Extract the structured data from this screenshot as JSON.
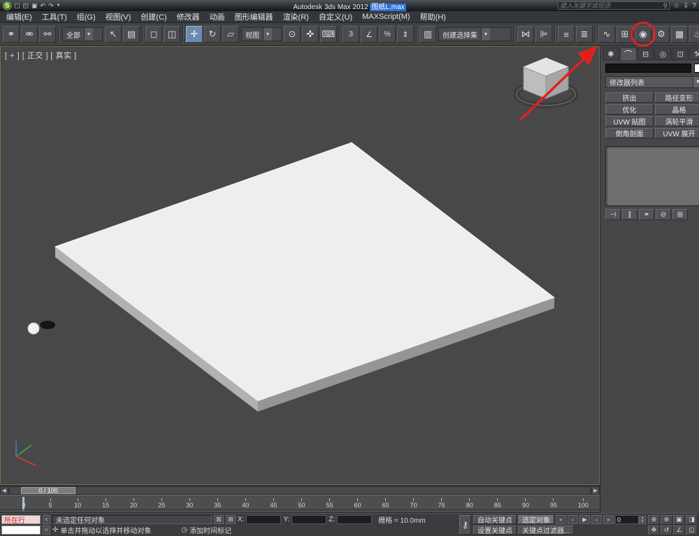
{
  "titlebar": {
    "app_title": "Autodesk 3ds Max  2012",
    "file_title": "图纸L.max",
    "search_placeholder": "键入关键字或短语"
  },
  "menubar": {
    "items": [
      "编辑(E)",
      "工具(T)",
      "组(G)",
      "视图(V)",
      "创建(C)",
      "修改器",
      "动画",
      "图形编辑器",
      "渲染(R)",
      "自定义(U)",
      "MAXScript(M)",
      "帮助(H)"
    ]
  },
  "toolbar": {
    "selection_filter": "全部",
    "ref_coord": "视图",
    "named_selection": "创建选择集"
  },
  "viewport": {
    "label": "[ + ] [ 正交 ] [ 真实 ]"
  },
  "command_panel": {
    "modifier_list": "修改器列表",
    "modifier_buttons": [
      "挤出",
      "路径变形",
      "优化",
      "晶格",
      "UVW 贴图",
      "涡轮平滑",
      "倒角剖面",
      "UVW 展开"
    ]
  },
  "timeline": {
    "slider_label": "0 / 100",
    "ticks": [
      "0",
      "5",
      "10",
      "15",
      "20",
      "25",
      "30",
      "35",
      "40",
      "45",
      "50",
      "55",
      "60",
      "65",
      "70",
      "75",
      "80",
      "85",
      "90",
      "95",
      "100"
    ]
  },
  "statusbar": {
    "listener_label": "所在行",
    "expand": "<",
    "status_text": "未选定任何对象",
    "x_label": "X:",
    "y_label": "Y:",
    "z_label": "Z:",
    "grid_text": "栅格 = 10.0mm",
    "auto_key": "自动关键点",
    "selected_filter": "选定对象",
    "set_key": "设置关键点",
    "key_filters": "关键点过滤器...",
    "frame": "0",
    "prompt": "单击并拖动以选择并移动对象",
    "add_time_tag": "添加时间标记"
  },
  "icons": {
    "logo": "S",
    "new_file": "▢",
    "open_file": "◰",
    "save": "▣",
    "undo": "↶",
    "redo": "↷",
    "dropdown": "▼",
    "search": "⚲",
    "favorites_star": "☆",
    "download": "⇩",
    "help": "?",
    "link": "⚭",
    "unlink": "⚮",
    "bind_spacewarp": "⚯",
    "select_object": "↖",
    "select_by_name": "▤",
    "region_rect": "◻",
    "window_crossing": "◫",
    "move": "✛",
    "rotate": "↻",
    "scale": "▱",
    "pivot_center": "⊙",
    "manipulate": "✜",
    "keyboard_override": "⌨",
    "snap3": "3",
    "angle_snap": "∠",
    "percent_snap": "%",
    "spinner_snap": "⇕",
    "edit_named_sel": "▥",
    "mirror": "⋈",
    "align": "⊫",
    "layers": "≡",
    "ribbon": "≣",
    "curve_editor": "∿",
    "schematic": "⊞",
    "material_editor": "◉",
    "render_setup": "⚙",
    "rendered_frame": "▦",
    "render": "♨",
    "render_last": "◍",
    "tab_create": "✱",
    "tab_modify": "⌒",
    "tab_hierarchy": "⊟",
    "tab_motion": "◎",
    "tab_display": "⊡",
    "tab_utilities": "⚒",
    "pin_stack": "⊣",
    "show_end": "∥",
    "make_unique": "⚭",
    "remove_mod": "⊘",
    "config_sets": "⊞",
    "lock_sel": "⊠",
    "abs_mode": "⊞",
    "goto_start": "«",
    "prev_frame": "‹",
    "play": "▶",
    "next_frame": "›",
    "goto_end": "»",
    "key_toggle": "⚷",
    "spin_up": "▴",
    "spin_down": "▾",
    "zoom": "⊕",
    "zoom_all": "⊛",
    "zoom_ext": "▣",
    "zoom_ext_all": "◨",
    "pan": "✥",
    "orbit": "↺",
    "maximize": "◱",
    "fov": "∠",
    "clock": "◷",
    "prompt_cursor": "✛",
    "slider_left": "◀",
    "slider_right": "▶"
  },
  "colors": {
    "annotation_red": "#e02020",
    "selection_blue": "#2a6fd6",
    "active_tool": "#6d8ab0"
  }
}
